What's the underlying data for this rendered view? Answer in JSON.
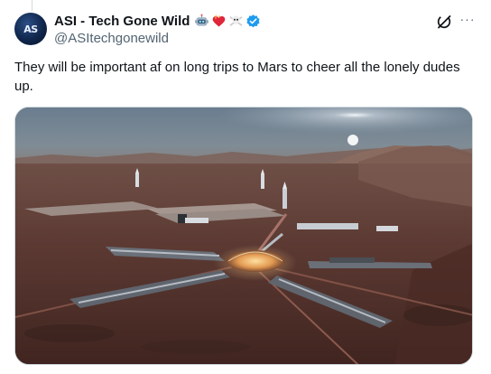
{
  "author": {
    "display_name": "ASI - Tech Gone Wild",
    "handle": "@ASItechgonewild",
    "avatar_text": "AS",
    "badges": [
      "robot-emoji",
      "flaming-heart-emoji",
      "skull-crossbones-emoji",
      "verified-badge"
    ]
  },
  "post": {
    "text": "They will be important af on long trips to Mars to cheer all the lonely dudes up.",
    "media": {
      "subject": "mars-base-illustration"
    }
  },
  "actions": {
    "grok_icon": "grok-icon",
    "more_icon": "more-icon"
  },
  "colors": {
    "text_primary": "#0f1419",
    "text_secondary": "#536471",
    "verified": "#1d9bf0",
    "border": "#cfd9de"
  }
}
